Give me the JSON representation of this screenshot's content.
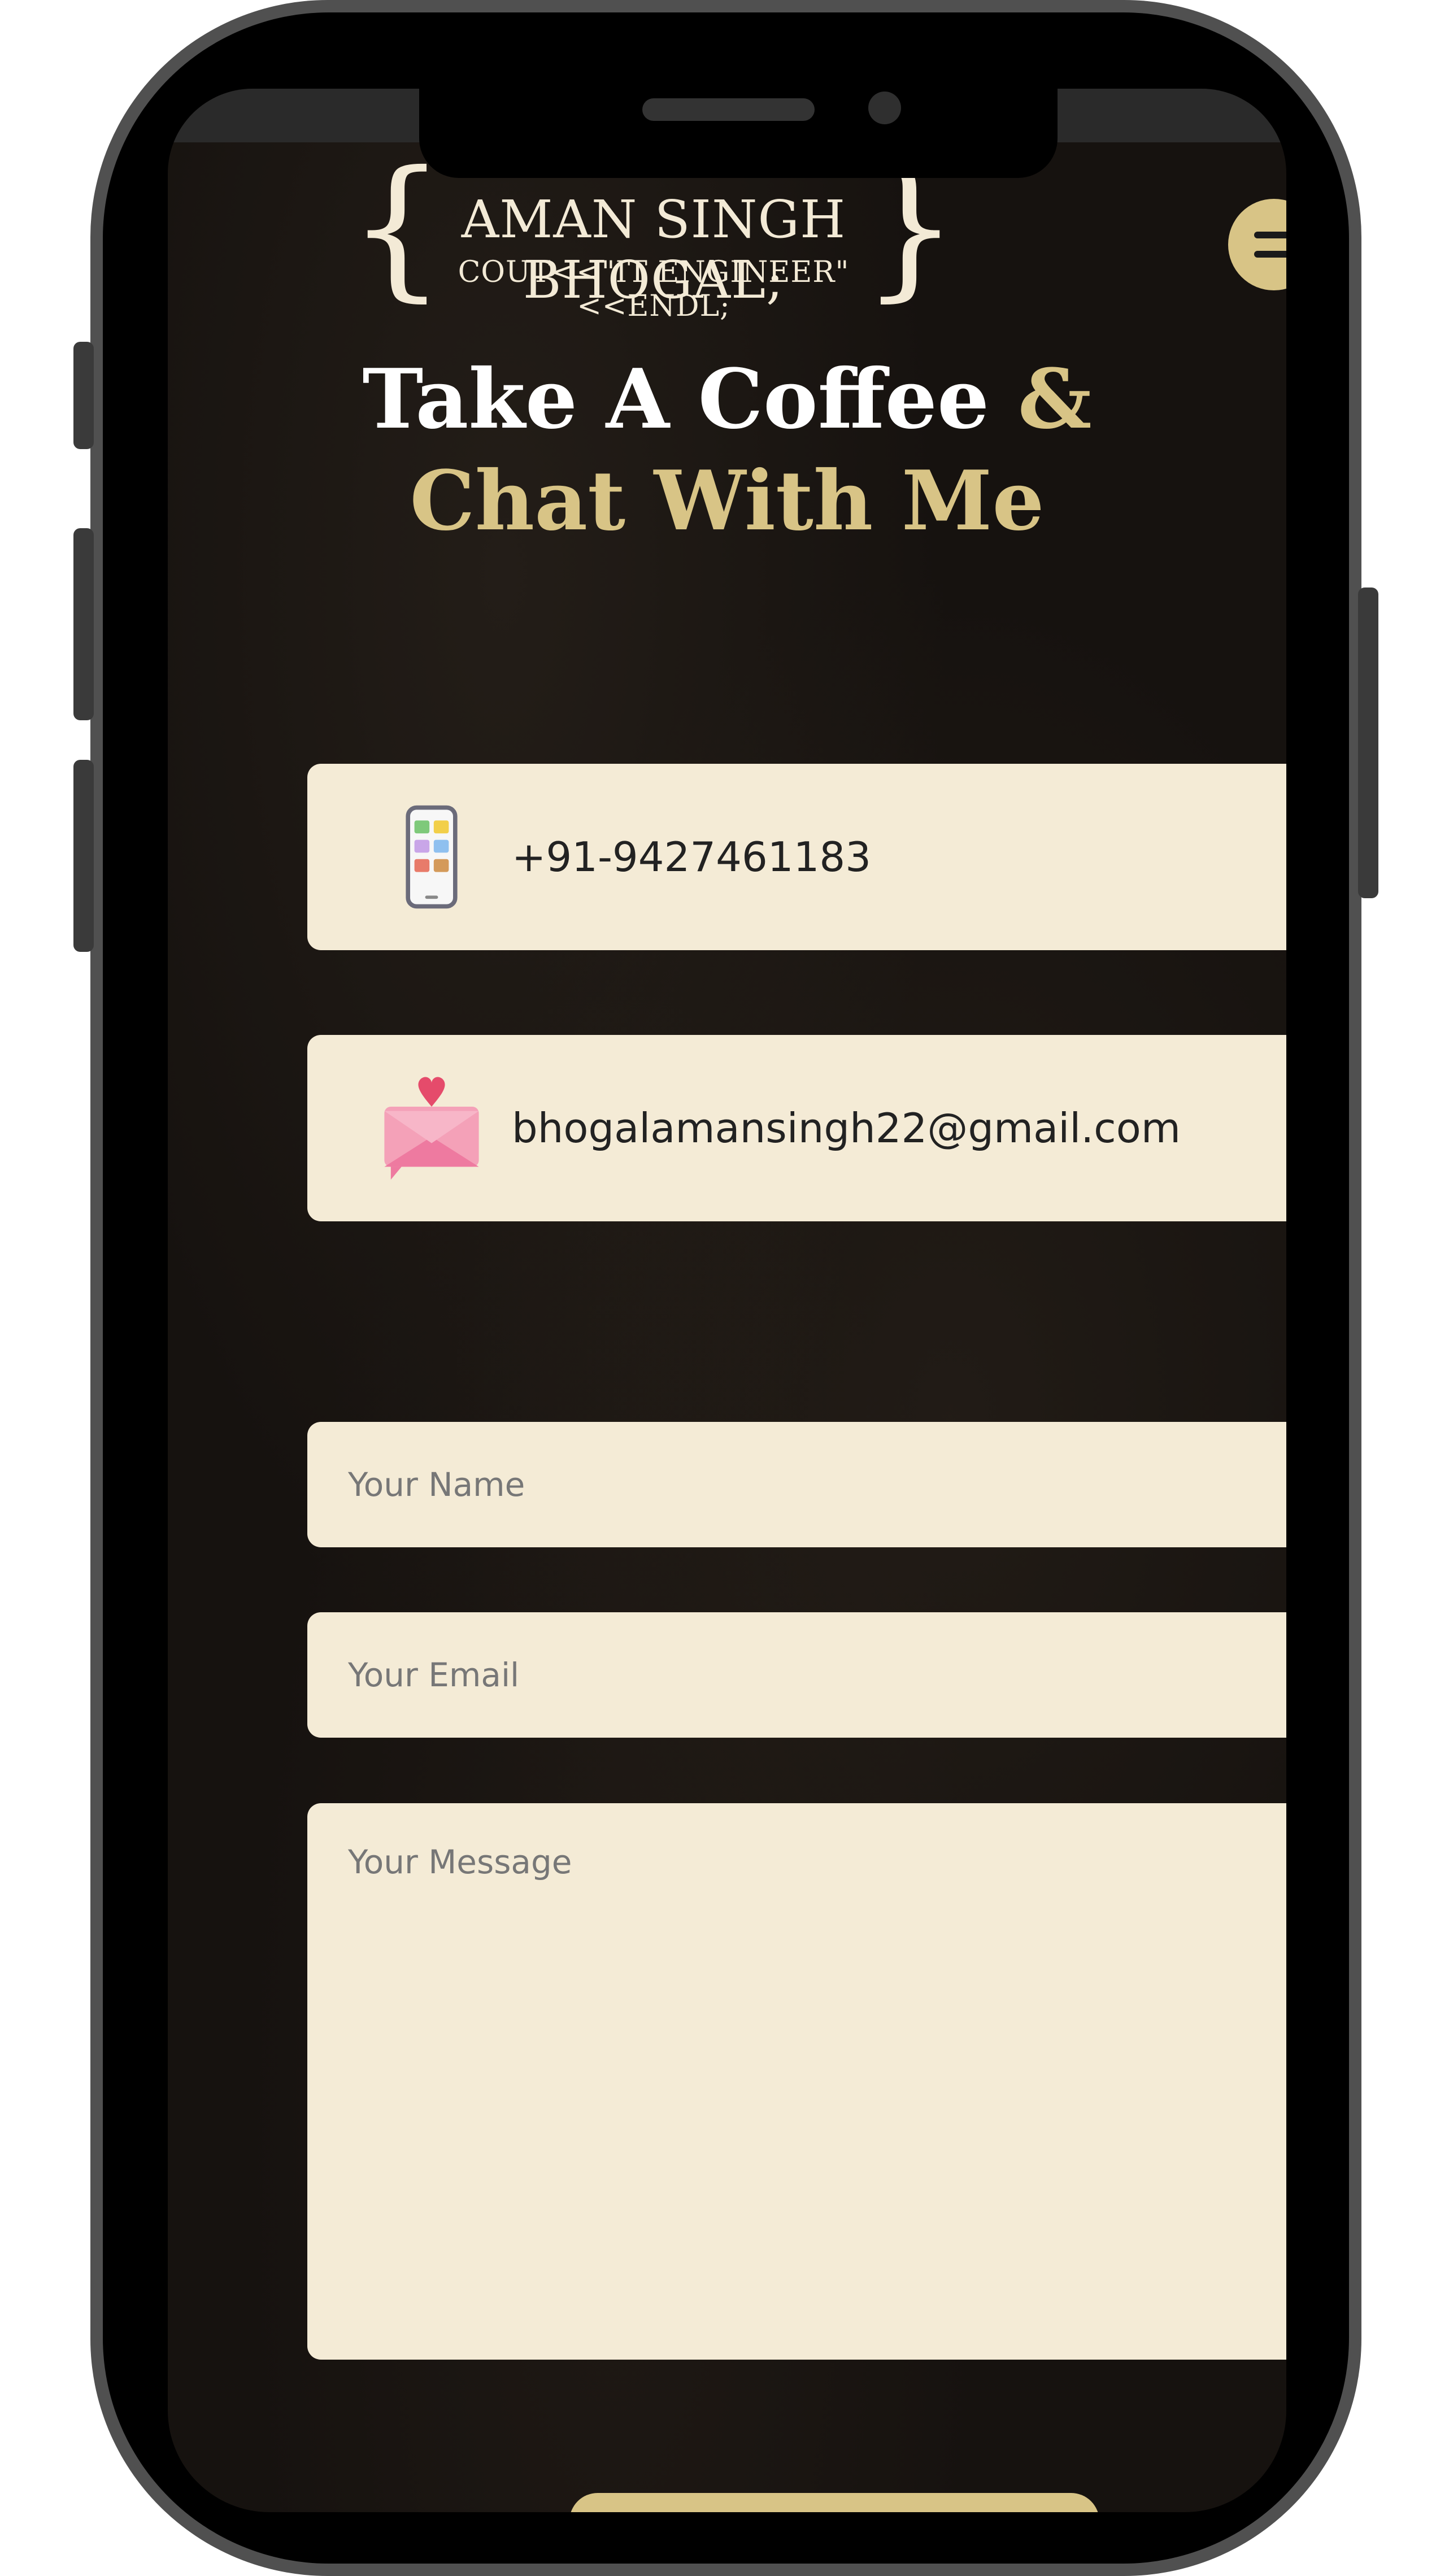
{
  "header": {
    "logo_name": "AMAN SINGH BHOGAL;",
    "logo_sub": "COUT<<\"IT ENGINEER\"<<ENDL;",
    "menu_icon": "hamburger-menu-icon"
  },
  "hero": {
    "title_part1": "Take A Coffee",
    "title_part2": "& Chat With Me"
  },
  "contact": {
    "phone": "+91-9427461183",
    "phone_icon": "smartphone-icon",
    "email": "bhogalamansingh22@gmail.com",
    "email_icon": "envelope-heart-icon"
  },
  "form": {
    "name_placeholder": "Your Name",
    "email_placeholder": "Your Email",
    "message_placeholder": "Your Message"
  },
  "colors": {
    "accent": "#d8c486",
    "card_bg": "#f4ebd6",
    "page_bg": "#16120f"
  }
}
